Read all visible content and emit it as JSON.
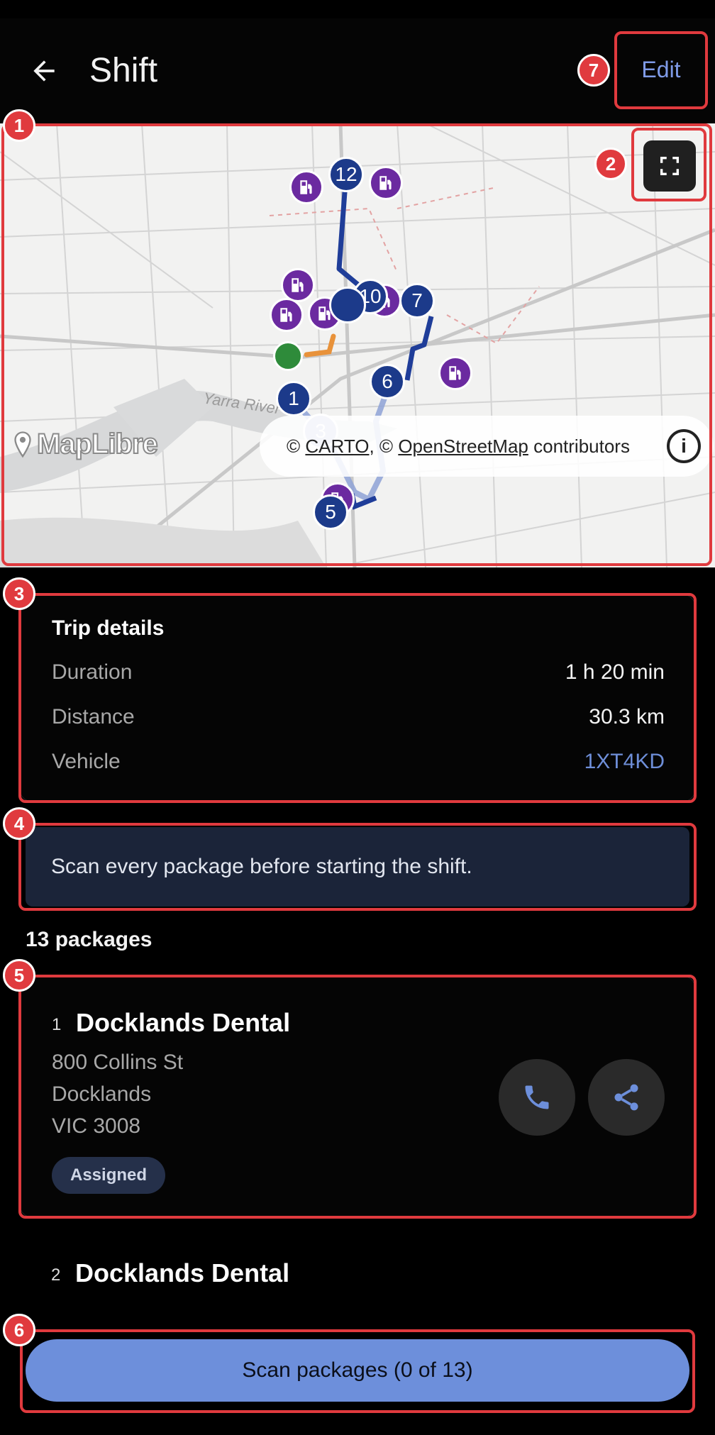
{
  "header": {
    "title": "Shift",
    "edit_label": "Edit"
  },
  "map": {
    "stops": [
      "12",
      "10",
      "7",
      "6",
      "1",
      "3",
      "5"
    ],
    "river_label": "Yarra River",
    "logo_text": "MapLibre",
    "attribution": {
      "prefix": "©",
      "carto": "CARTO",
      "sep": ", ©",
      "osm": "OpenStreetMap",
      "suffix": "contributors"
    },
    "info_glyph": "i"
  },
  "trip": {
    "title": "Trip details",
    "rows": [
      {
        "label": "Duration",
        "value": "1 h 20 min"
      },
      {
        "label": "Distance",
        "value": "30.3 km"
      },
      {
        "label": "Vehicle",
        "value": "1XT4KD"
      }
    ]
  },
  "banner": {
    "text": "Scan every package before starting the shift."
  },
  "packages": {
    "count_label": "13 packages",
    "items": [
      {
        "index": "1",
        "name": "Docklands Dental",
        "address": [
          "800 Collins St",
          "Docklands",
          "VIC 3008"
        ],
        "status": "Assigned"
      },
      {
        "index": "2",
        "name": "Docklands Dental"
      }
    ]
  },
  "scan_button": {
    "label": "Scan packages (0 of 13)"
  },
  "annotations": [
    "1",
    "2",
    "3",
    "4",
    "5",
    "6",
    "7"
  ],
  "colors": {
    "accent": "#6d8fdb",
    "route": "#1f3d99",
    "fuel": "#6b2aa0",
    "start": "#2e8b3a",
    "marker": "#e03a3e"
  }
}
